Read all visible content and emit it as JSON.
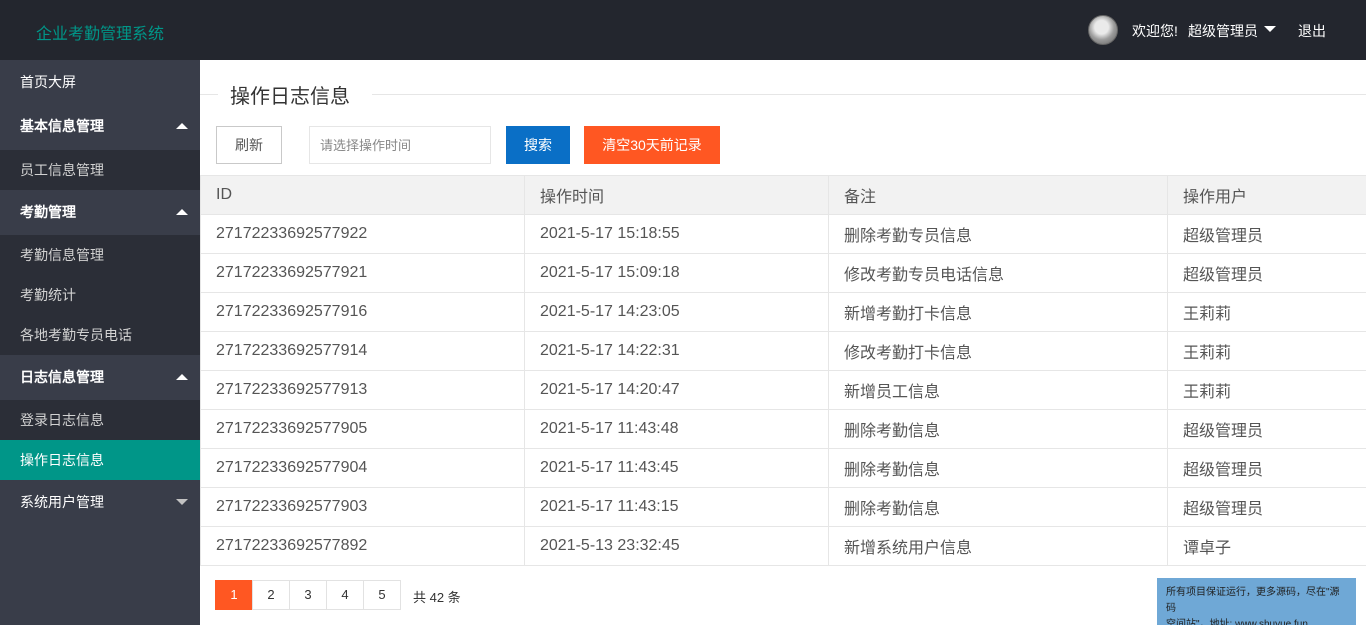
{
  "header": {
    "app_title": "企业考勤管理系统",
    "welcome": "欢迎您!",
    "user_name": "超级管理员",
    "logout": "退出"
  },
  "sidebar": {
    "home": "首页大屏",
    "groups": [
      {
        "label": "基本信息管理",
        "items": [
          "员工信息管理"
        ]
      },
      {
        "label": "考勤管理",
        "items": [
          "考勤信息管理",
          "考勤统计",
          "各地考勤专员电话"
        ]
      },
      {
        "label": "日志信息管理",
        "items": [
          "登录日志信息",
          "操作日志信息"
        ]
      },
      {
        "label": "系统用户管理",
        "items": []
      }
    ],
    "active_item": "操作日志信息"
  },
  "main": {
    "title": "操作日志信息",
    "toolbar": {
      "refresh_label": "刷新",
      "time_placeholder": "请选择操作时间",
      "search_label": "搜索",
      "clear_label": "清空30天前记录"
    },
    "table": {
      "columns": [
        "ID",
        "操作时间",
        "备注",
        "操作用户"
      ],
      "rows": [
        [
          "27172233692577922",
          "2021-5-17 15:18:55",
          "删除考勤专员信息",
          "超级管理员"
        ],
        [
          "27172233692577921",
          "2021-5-17 15:09:18",
          "修改考勤专员电话信息",
          "超级管理员"
        ],
        [
          "27172233692577916",
          "2021-5-17 14:23:05",
          "新增考勤打卡信息",
          "王莉莉"
        ],
        [
          "27172233692577914",
          "2021-5-17 14:22:31",
          "修改考勤打卡信息",
          "王莉莉"
        ],
        [
          "27172233692577913",
          "2021-5-17 14:20:47",
          "新增员工信息",
          "王莉莉"
        ],
        [
          "27172233692577905",
          "2021-5-17 11:43:48",
          "删除考勤信息",
          "超级管理员"
        ],
        [
          "27172233692577904",
          "2021-5-17 11:43:45",
          "删除考勤信息",
          "超级管理员"
        ],
        [
          "27172233692577903",
          "2021-5-17 11:43:15",
          "删除考勤信息",
          "超级管理员"
        ],
        [
          "27172233692577892",
          "2021-5-13 23:32:45",
          "新增系统用户信息",
          "谭卓子"
        ]
      ]
    },
    "pagination": {
      "pages": [
        "1",
        "2",
        "3",
        "4",
        "5"
      ],
      "current": "1",
      "total_text": "共 42 条"
    }
  },
  "notice": {
    "line1": "所有项目保证运行，更多源码，尽在\"源码",
    "line2": "空间站\"，地址: www.shuyue.fun"
  },
  "colors": {
    "header_bg": "#23262e",
    "sidebar_bg": "#393d49",
    "accent": "#009688",
    "primary_button": "#0a6fc6",
    "danger_button": "#ff5722"
  }
}
